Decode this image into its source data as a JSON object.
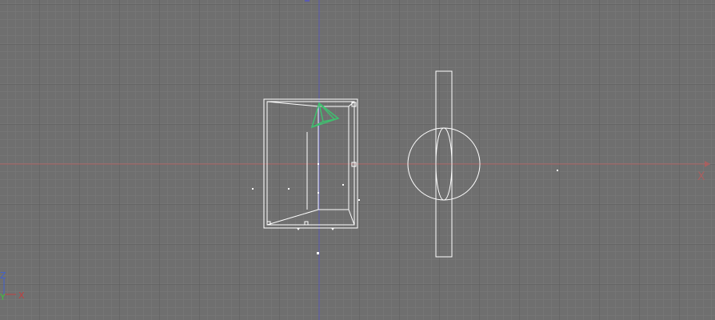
{
  "viewport": {
    "axis_label_x": "X",
    "gizmo": {
      "z_label": "Z",
      "x_label": "X",
      "y_label": "Y"
    }
  },
  "colors": {
    "background": "#6f6f6f",
    "grid_minor": "#7a7a7a",
    "grid_major": "#5f5f5f",
    "x_axis": "#a86060",
    "y_axis": "#5a5ab0",
    "wireframe": "#ffffff",
    "selection": "#3fbf6f",
    "gizmo_x": "#c04040",
    "gizmo_y": "#40c040",
    "gizmo_z": "#4060d0"
  },
  "icons": {
    "camera": "camera-icon",
    "gizmo": "axis-gizmo-icon"
  }
}
